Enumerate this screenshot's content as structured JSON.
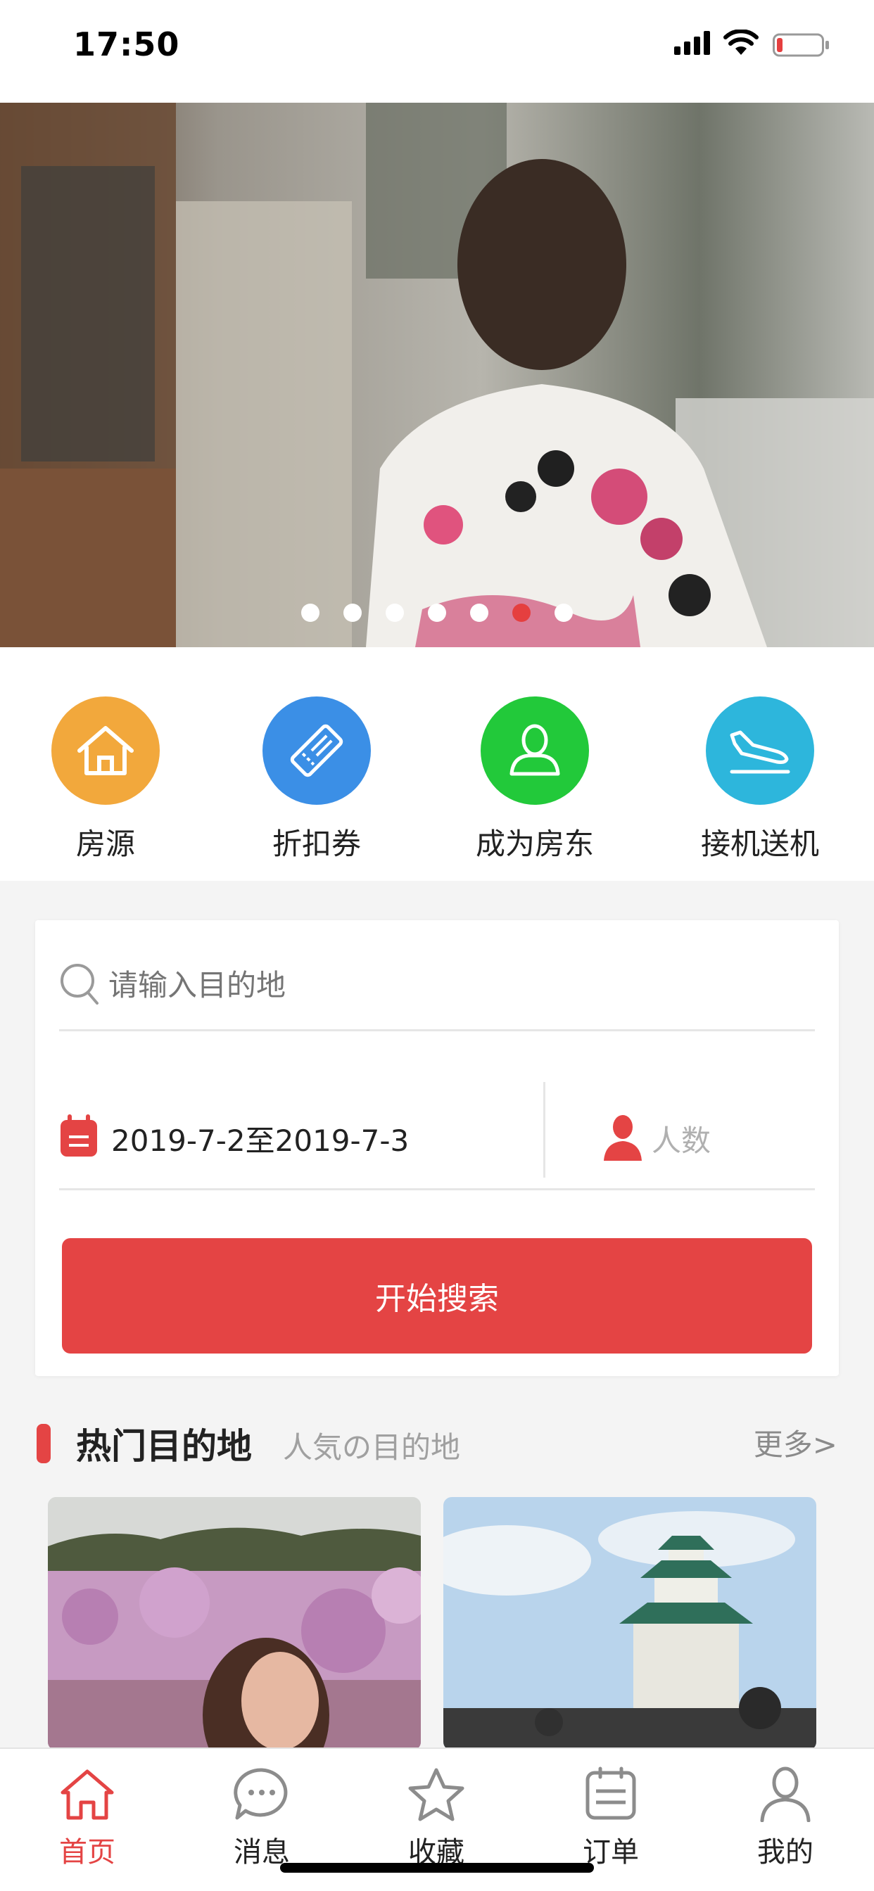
{
  "status_bar": {
    "time": "17:50"
  },
  "banner": {
    "slide_count": 7,
    "active_slide": 6
  },
  "quick_entries": [
    {
      "label": "房源",
      "icon": "house-icon",
      "color": "#f2a83c"
    },
    {
      "label": "折扣券",
      "icon": "ticket-icon",
      "color": "#3b8fe6"
    },
    {
      "label": "成为房东",
      "icon": "person-icon",
      "color": "#22c93a"
    },
    {
      "label": "接机送机",
      "icon": "airplane-landing-icon",
      "color": "#2db6dc"
    }
  ],
  "search": {
    "destination_placeholder": "请输入目的地",
    "date_range": "2019-7-2至2019-7-3",
    "guests_placeholder": "人数",
    "button_label": "开始搜索"
  },
  "hot_destinations": {
    "title": "热门目的地",
    "subtitle": "人気の目的地",
    "more_label": "更多>"
  },
  "tabbar": {
    "items": [
      {
        "label": "首页",
        "icon": "home-icon"
      },
      {
        "label": "消息",
        "icon": "message-icon"
      },
      {
        "label": "收藏",
        "icon": "star-icon"
      },
      {
        "label": "订单",
        "icon": "order-icon"
      },
      {
        "label": "我的",
        "icon": "profile-icon"
      }
    ],
    "active_index": 0
  },
  "colors": {
    "accent": "#e44444",
    "inactive_icon": "#8c8c8c"
  }
}
